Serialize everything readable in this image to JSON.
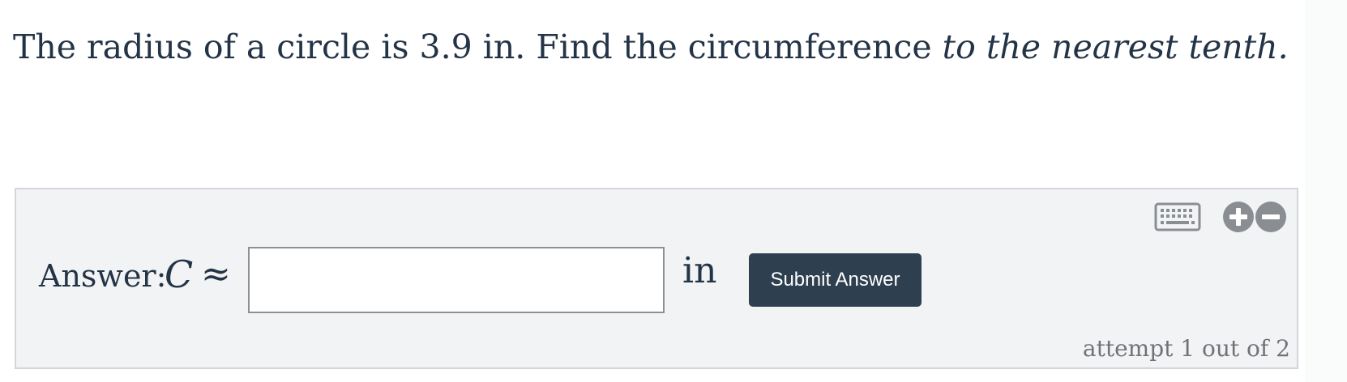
{
  "question": {
    "text_main": "The radius of a circle is 3.9 in. Find the circumference ",
    "text_emphasis": "to the nearest tenth."
  },
  "answer": {
    "label": "Answer:",
    "variable": "C",
    "approx_symbol": "≈",
    "input_value": "",
    "input_placeholder": "",
    "unit": "in",
    "submit_label": "Submit Answer"
  },
  "toolbar": {
    "keyboard_icon": "keyboard-icon",
    "zoom_in_icon": "plus-circle-icon",
    "zoom_out_icon": "minus-circle-icon"
  },
  "attempt": {
    "text": "attempt 1 out of 2"
  },
  "colors": {
    "text": "#243447",
    "button_bg": "#2e3f50",
    "panel_bg": "#f2f3f5",
    "panel_border": "#d2d6da",
    "icon_gray": "#8a8e93",
    "muted_text": "#6f7378"
  }
}
